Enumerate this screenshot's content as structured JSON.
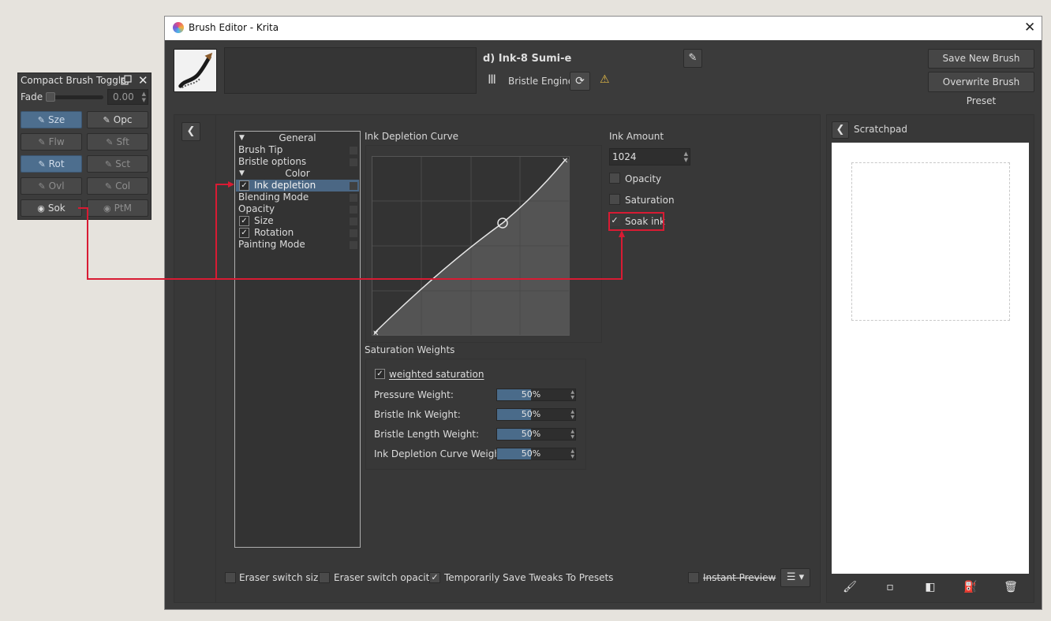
{
  "toggler": {
    "title": "Compact Brush Toggler",
    "fade_label": "Fade",
    "fade_value": "0.00",
    "fade_level": 0,
    "buttons": [
      {
        "label": "Sze",
        "state": "on"
      },
      {
        "label": "Opc",
        "state": "off-lit"
      },
      {
        "label": "Flw",
        "state": "off"
      },
      {
        "label": "Sft",
        "state": "off"
      },
      {
        "label": "Rot",
        "state": "on"
      },
      {
        "label": "Sct",
        "state": "off"
      },
      {
        "label": "Ovl",
        "state": "off"
      },
      {
        "label": "Col",
        "state": "off"
      },
      {
        "label": "Sok",
        "state": "off-lit"
      },
      {
        "label": "PtM",
        "state": "off"
      }
    ]
  },
  "window": {
    "title": "Brush Editor - Krita"
  },
  "preset": {
    "name": "d) Ink-8 Sumi-e",
    "engine": "Bristle Engine",
    "save_new": "Save New Brush Preset...",
    "overwrite": "Overwrite Brush Preset"
  },
  "options": {
    "items": [
      {
        "label": "General",
        "type": "header"
      },
      {
        "label": "Brush Tip",
        "type": "item"
      },
      {
        "label": "Bristle options",
        "type": "item"
      },
      {
        "label": "Color",
        "type": "header"
      },
      {
        "label": "Ink depletion",
        "type": "check",
        "checked": true,
        "selected": true
      },
      {
        "label": "Blending Mode",
        "type": "item"
      },
      {
        "label": "Opacity",
        "type": "item"
      },
      {
        "label": "Size",
        "type": "check",
        "checked": true
      },
      {
        "label": "Rotation",
        "type": "check",
        "checked": true
      },
      {
        "label": "Painting Mode",
        "type": "item"
      }
    ],
    "check_glyph": "✓"
  },
  "curve": {
    "title": "Ink Depletion Curve"
  },
  "saturation": {
    "title": "Saturation Weights",
    "weighted_label": "weighted saturation",
    "weighted_checked": true,
    "rows": [
      {
        "label": "Pressure Weight:",
        "value": "50%",
        "level": 0.5
      },
      {
        "label": "Bristle Ink Weight:",
        "value": "50%",
        "level": 0.5
      },
      {
        "label": "Bristle Length Weight:",
        "value": "50%",
        "level": 0.5
      },
      {
        "label": "Ink Depletion Curve Weight:",
        "value": "50%",
        "level": 0.5
      }
    ]
  },
  "ink": {
    "title": "Ink Amount",
    "amount": "1024",
    "opacity_label": "Opacity",
    "saturation_label": "Saturation",
    "soak_label": "Soak ink",
    "soak_checked": true
  },
  "bottom": {
    "eraser_size": "Eraser switch size",
    "eraser_opacity": "Eraser switch opacity",
    "temp_save": "Temporarily Save Tweaks To Presets",
    "instant_preview": "Instant Preview"
  },
  "scratchpad": {
    "title": "Scratchpad"
  },
  "colors": {
    "accent": "#4b6784",
    "annotation": "#d81b33",
    "panel": "#383838"
  }
}
